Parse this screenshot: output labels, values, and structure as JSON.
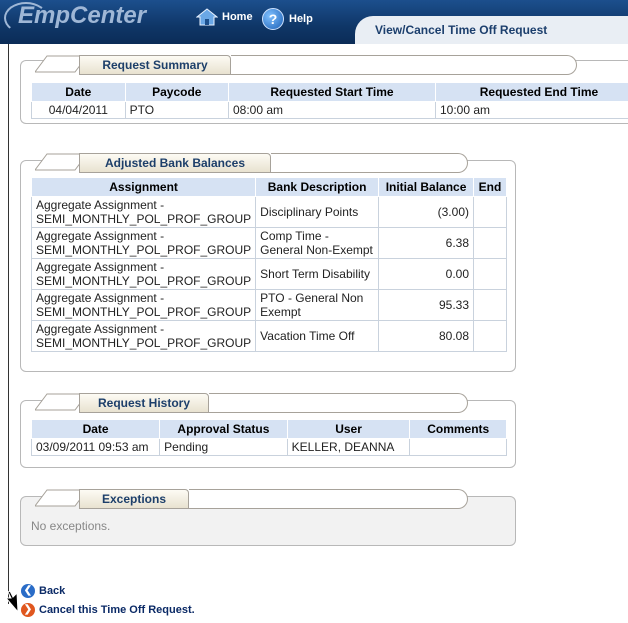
{
  "header": {
    "logo": "EmpCenter",
    "nav": [
      {
        "label": "Home",
        "icon": "home-icon"
      },
      {
        "label": "Help",
        "icon": "help-icon"
      }
    ],
    "page_tab": "View/Cancel Time Off Request"
  },
  "summary": {
    "title": "Request Summary",
    "columns": [
      "Date",
      "Paycode",
      "Requested Start Time",
      "Requested End Time"
    ],
    "row": [
      "04/04/2011",
      "PTO",
      "08:00 am",
      "10:00 am"
    ]
  },
  "balances": {
    "title": "Adjusted Bank Balances",
    "columns": [
      "Assignment",
      "Bank Description",
      "Initial Balance",
      "End"
    ],
    "rows": [
      {
        "assignment_1": "Aggregate Assignment -",
        "assignment_2": "SEMI_MONTHLY_POL_PROF_GROUP",
        "bank_1": "Disciplinary Points",
        "bank_2": "",
        "initial": "(3.00)"
      },
      {
        "assignment_1": "Aggregate Assignment -",
        "assignment_2": "SEMI_MONTHLY_POL_PROF_GROUP",
        "bank_1": "Comp Time -",
        "bank_2": "General Non-Exempt",
        "initial": "6.38"
      },
      {
        "assignment_1": "Aggregate Assignment -",
        "assignment_2": "SEMI_MONTHLY_POL_PROF_GROUP",
        "bank_1": "Short Term Disability",
        "bank_2": "",
        "initial": "0.00"
      },
      {
        "assignment_1": "Aggregate Assignment -",
        "assignment_2": "SEMI_MONTHLY_POL_PROF_GROUP",
        "bank_1": "PTO - General Non",
        "bank_2": "Exempt",
        "initial": "95.33"
      },
      {
        "assignment_1": "Aggregate Assignment -",
        "assignment_2": "SEMI_MONTHLY_POL_PROF_GROUP",
        "bank_1": "Vacation Time Off",
        "bank_2": "",
        "initial": "80.08"
      }
    ]
  },
  "history": {
    "title": "Request History",
    "columns": [
      "Date",
      "Approval Status",
      "User",
      "Comments"
    ],
    "row": [
      "03/09/2011 09:53 am",
      "Pending",
      "KELLER, DEANNA",
      ""
    ]
  },
  "exceptions": {
    "title": "Exceptions",
    "text": "No exceptions."
  },
  "actions": {
    "back": "Back",
    "cancel": "Cancel this Time Off Request."
  }
}
